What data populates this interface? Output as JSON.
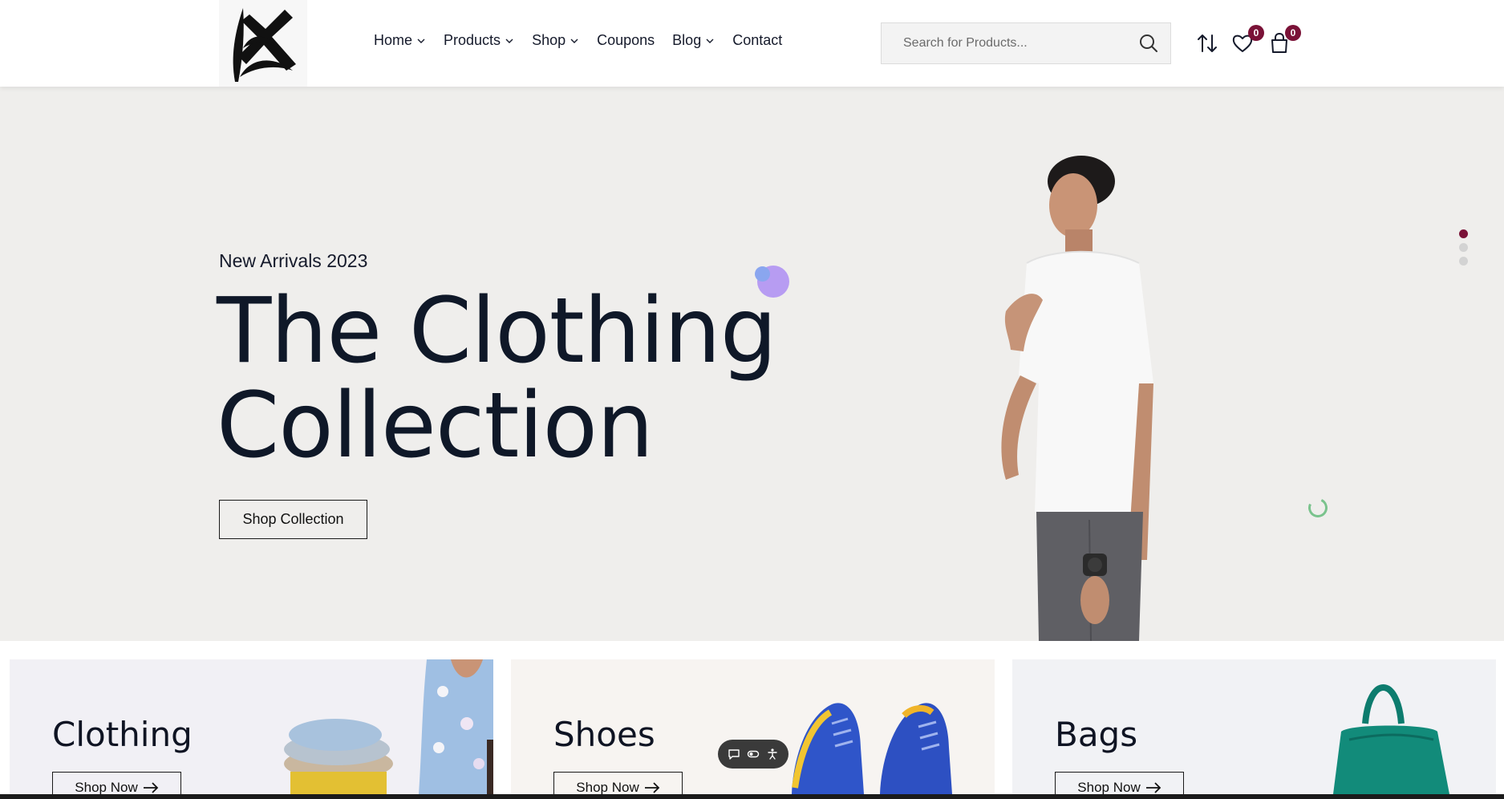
{
  "header": {
    "logo_icon": "brand-logo-icon",
    "nav": [
      {
        "label": "Home",
        "has_dropdown": true
      },
      {
        "label": "Products",
        "has_dropdown": true
      },
      {
        "label": "Shop",
        "has_dropdown": true
      },
      {
        "label": "Coupons",
        "has_dropdown": false
      },
      {
        "label": "Blog",
        "has_dropdown": true
      },
      {
        "label": "Contact",
        "has_dropdown": false
      }
    ],
    "search": {
      "placeholder": "Search for Products...",
      "value": "",
      "icon": "search-icon"
    },
    "compare": {
      "icon": "sort-arrows-icon"
    },
    "wishlist": {
      "icon": "heart-icon",
      "count": "0"
    },
    "cart": {
      "icon": "shopping-bag-icon",
      "count": "0"
    }
  },
  "hero": {
    "subtitle": "New Arrivals 2023",
    "title_line1": "The Clothing",
    "title_line2": "Collection",
    "cta": "Shop Collection",
    "slides": 3,
    "active_slide": 1
  },
  "categories": [
    {
      "title": "Clothing",
      "cta": "Shop Now",
      "bg": "#f1f0f5"
    },
    {
      "title": "Shoes",
      "cta": "Shop Now",
      "bg": "#f7f4f1"
    },
    {
      "title": "Bags",
      "cta": "Shop Now",
      "bg": "#f1f2f5"
    }
  ],
  "widget": {
    "icons": [
      "chat-icon",
      "toggle-icon",
      "accessibility-icon"
    ]
  },
  "colors": {
    "accent": "#7a1237",
    "hero_bg": "#efeeec",
    "text": "#0f1828"
  }
}
